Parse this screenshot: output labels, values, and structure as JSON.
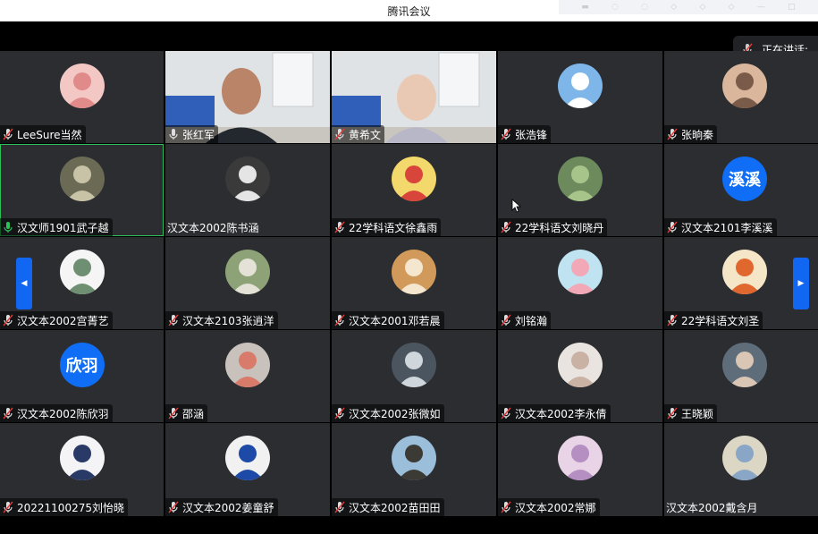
{
  "window": {
    "title": "腾讯会议"
  },
  "speaking": {
    "label": "正在讲话:"
  },
  "colors": {
    "accent": "#1166f2",
    "active_border": "#2fbf5a",
    "tile_bg": "#2b2d31"
  },
  "participants": [
    {
      "name": "LeeSure当然",
      "mic": "muted",
      "avatar": {
        "type": "image",
        "bg": "#f3c7c4",
        "fg": "#e08a8a"
      }
    },
    {
      "name": "张红军",
      "mic": "on",
      "avatar": {
        "type": "video"
      }
    },
    {
      "name": "黄希文",
      "mic": "muted",
      "avatar": {
        "type": "video"
      }
    },
    {
      "name": "张浩锋",
      "mic": "muted",
      "avatar": {
        "type": "image",
        "bg": "#7fb6ea",
        "fg": "#ffffff"
      }
    },
    {
      "name": "张晌秦",
      "mic": "muted",
      "avatar": {
        "type": "image",
        "bg": "#d9b69c",
        "fg": "#7a5a48"
      }
    },
    {
      "name": "汉文师1901武子越",
      "mic": "speaking",
      "avatar": {
        "type": "image",
        "bg": "#6b6a55",
        "fg": "#c8c3a6"
      }
    },
    {
      "name": "汉文本2002陈书涵",
      "mic": "none",
      "avatar": {
        "type": "image",
        "bg": "#3a3a3a",
        "fg": "#e5e5e5"
      }
    },
    {
      "name": "22学科语文徐鑫雨",
      "mic": "muted",
      "avatar": {
        "type": "image",
        "bg": "#f3d86b",
        "fg": "#d8453a"
      }
    },
    {
      "name": "22学科语文刘晓丹",
      "mic": "muted",
      "avatar": {
        "type": "image",
        "bg": "#6d8a5c",
        "fg": "#a7c48a"
      }
    },
    {
      "name": "汉文本2101李溪溪",
      "mic": "muted",
      "avatar": {
        "type": "text",
        "text": "溪溪",
        "bg": "#0f6ef5"
      }
    },
    {
      "name": "汉文本2002宫菁艺",
      "mic": "muted",
      "avatar": {
        "type": "image",
        "bg": "#f5f5f5",
        "fg": "#6f8f72"
      }
    },
    {
      "name": "汉文本2103张逍洋",
      "mic": "muted",
      "avatar": {
        "type": "image",
        "bg": "#8da377",
        "fg": "#e4e1d6"
      }
    },
    {
      "name": "汉文本2001邓若晨",
      "mic": "muted",
      "avatar": {
        "type": "image",
        "bg": "#d19a5a",
        "fg": "#f4e6cf"
      }
    },
    {
      "name": "刘铭瀚",
      "mic": "muted",
      "avatar": {
        "type": "image",
        "bg": "#bfe3f0",
        "fg": "#f2a8b6"
      }
    },
    {
      "name": "22学科语文刘圣",
      "mic": "muted",
      "avatar": {
        "type": "image",
        "bg": "#f6e6c8",
        "fg": "#e0672e"
      }
    },
    {
      "name": "汉文本2002陈欣羽",
      "mic": "muted",
      "avatar": {
        "type": "text",
        "text": "欣羽",
        "bg": "#0f6ef5"
      }
    },
    {
      "name": "邵涵",
      "mic": "muted",
      "avatar": {
        "type": "image",
        "bg": "#c9c1bb",
        "fg": "#d97b6b"
      }
    },
    {
      "name": "汉文本2002张微如",
      "mic": "muted",
      "avatar": {
        "type": "image",
        "bg": "#4a5560",
        "fg": "#cfd6dc"
      }
    },
    {
      "name": "汉文本2002李永倩",
      "mic": "muted",
      "avatar": {
        "type": "image",
        "bg": "#e9e4df",
        "fg": "#c9b1a4"
      }
    },
    {
      "name": "王晓颖",
      "mic": "muted",
      "avatar": {
        "type": "image",
        "bg": "#5f6d7a",
        "fg": "#d9c6b4"
      }
    },
    {
      "name": "20221100275刘怡晓",
      "mic": "muted",
      "avatar": {
        "type": "image",
        "bg": "#f4f4f6",
        "fg": "#2a3a66"
      }
    },
    {
      "name": "汉文本2002姜童舒",
      "mic": "muted",
      "avatar": {
        "type": "image",
        "bg": "#f1f1f1",
        "fg": "#1d4aa6"
      }
    },
    {
      "name": "汉文本2002苗田田",
      "mic": "muted",
      "avatar": {
        "type": "image",
        "bg": "#9bbfda",
        "fg": "#3c3a34"
      }
    },
    {
      "name": "汉文本2002常娜",
      "mic": "muted",
      "avatar": {
        "type": "image",
        "bg": "#e8d4e6",
        "fg": "#b58fc2"
      }
    },
    {
      "name": "汉文本2002戴含月",
      "mic": "none",
      "avatar": {
        "type": "image",
        "bg": "#dcd6c4",
        "fg": "#8aa6c6"
      }
    }
  ]
}
